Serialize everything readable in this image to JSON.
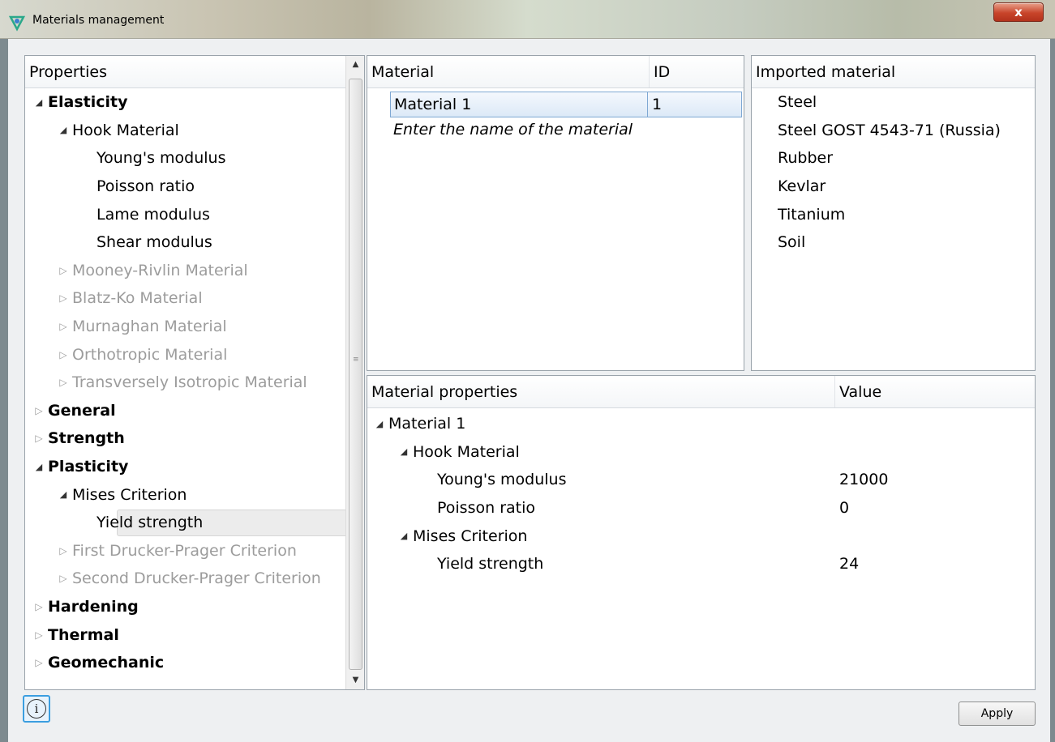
{
  "window": {
    "title": "Materials management",
    "close_label": "x"
  },
  "properties": {
    "header": "Properties",
    "tree": [
      {
        "label": "Elasticity",
        "level": 0,
        "expanded": true,
        "bold": true
      },
      {
        "label": "Hook Material",
        "level": 1,
        "expanded": true
      },
      {
        "label": "Young's modulus",
        "level": 2
      },
      {
        "label": "Poisson ratio",
        "level": 2
      },
      {
        "label": "Lame modulus",
        "level": 2
      },
      {
        "label": "Shear modulus",
        "level": 2
      },
      {
        "label": "Mooney-Rivlin Material",
        "level": 1,
        "expanded": false,
        "disabled": true
      },
      {
        "label": "Blatz-Ko Material",
        "level": 1,
        "expanded": false,
        "disabled": true
      },
      {
        "label": "Murnaghan Material",
        "level": 1,
        "expanded": false,
        "disabled": true
      },
      {
        "label": "Orthotropic Material",
        "level": 1,
        "expanded": false,
        "disabled": true
      },
      {
        "label": "Transversely Isotropic Material",
        "level": 1,
        "expanded": false,
        "disabled": true
      },
      {
        "label": "General",
        "level": 0,
        "expanded": false,
        "bold": true
      },
      {
        "label": "Strength",
        "level": 0,
        "expanded": false,
        "bold": true
      },
      {
        "label": "Plasticity",
        "level": 0,
        "expanded": true,
        "bold": true
      },
      {
        "label": "Mises Criterion",
        "level": 1,
        "expanded": true
      },
      {
        "label": "Yield strength",
        "level": 2,
        "selected": true
      },
      {
        "label": "First Drucker-Prager Criterion",
        "level": 1,
        "expanded": false,
        "disabled": true
      },
      {
        "label": "Second Drucker-Prager Criterion",
        "level": 1,
        "expanded": false,
        "disabled": true
      },
      {
        "label": "Hardening",
        "level": 0,
        "expanded": false,
        "bold": true
      },
      {
        "label": "Thermal",
        "level": 0,
        "expanded": false,
        "bold": true
      },
      {
        "label": "Geomechanic",
        "level": 0,
        "expanded": false,
        "bold": true
      }
    ]
  },
  "materials": {
    "header_name": "Material",
    "header_id": "ID",
    "selected": {
      "name": "Material 1",
      "id": "1"
    },
    "placeholder": "Enter the name of the material"
  },
  "imported": {
    "header": "Imported material",
    "items": [
      "Steel",
      "Steel GOST 4543-71 (Russia)",
      "Rubber",
      "Kevlar",
      "Titanium",
      "Soil"
    ]
  },
  "material_properties": {
    "header_name": "Material properties",
    "header_value": "Value",
    "rows": [
      {
        "label": "Material 1",
        "level": 0,
        "expanded": true,
        "value": ""
      },
      {
        "label": "Hook Material",
        "level": 1,
        "expanded": true,
        "value": ""
      },
      {
        "label": "Young's modulus",
        "level": 2,
        "value": "21000"
      },
      {
        "label": "Poisson ratio",
        "level": 2,
        "value": "0"
      },
      {
        "label": "Mises Criterion",
        "level": 1,
        "expanded": true,
        "value": ""
      },
      {
        "label": "Yield strength",
        "level": 2,
        "value": "24"
      }
    ]
  },
  "buttons": {
    "info": "i",
    "apply": "Apply"
  }
}
